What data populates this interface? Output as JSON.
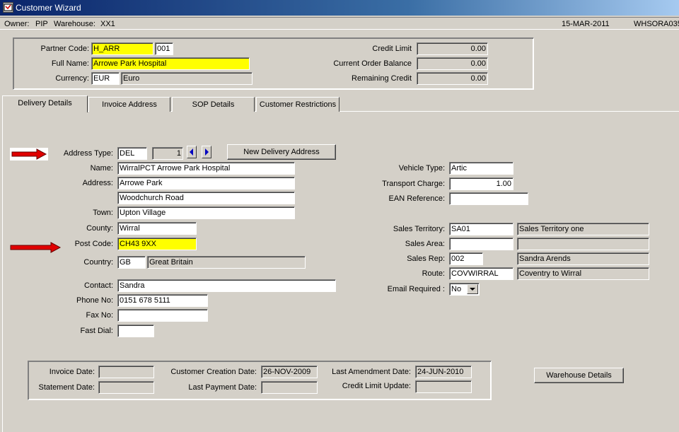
{
  "window": {
    "title": "Customer Wizard",
    "app_icon": "app-icon"
  },
  "infobar": {
    "owner_label": "Owner:",
    "owner": "PIP",
    "warehouse_label": "Warehouse:",
    "warehouse": "XX1",
    "date": "15-MAR-2011",
    "server": "WHSORA035"
  },
  "header": {
    "partner_code_label": "Partner Code:",
    "partner_code": "H_ARR",
    "partner_suffix": "001",
    "full_name_label": "Full Name:",
    "full_name": "Arrowe Park Hospital",
    "currency_label": "Currency:",
    "currency_code": "EUR",
    "currency_name": "Euro",
    "credit_limit_label": "Credit Limit",
    "credit_limit": "0.00",
    "current_order_balance_label": "Current Order Balance",
    "current_order_balance": "0.00",
    "remaining_credit_label": "Remaining Credit",
    "remaining_credit": "0.00"
  },
  "tabs": [
    {
      "label": "Delivery Details",
      "active": true
    },
    {
      "label": "Invoice Address",
      "active": false
    },
    {
      "label": "SOP Details",
      "active": false
    },
    {
      "label": "Customer Restrictions",
      "active": false
    }
  ],
  "delivery": {
    "address_type_label": "Address Type:",
    "address_type": "DEL",
    "address_index": "1",
    "new_delivery_address_button": "New Delivery Address",
    "name_label": "Name:",
    "name": "WirralPCT Arrowe Park Hospital",
    "address_label": "Address:",
    "address_line1": "Arrowe Park",
    "address_line2": "Woodchurch Road",
    "town_label": "Town:",
    "town": "Upton Village",
    "county_label": "County:",
    "county": "Wirral",
    "post_code_label": "Post Code:",
    "post_code": "CH43 9XX",
    "country_label": "Country:",
    "country_code": "GB",
    "country_name": "Great Britain",
    "contact_label": "Contact:",
    "contact": "Sandra",
    "phone_label": "Phone No:",
    "phone": "0151 678 5111",
    "fax_label": "Fax No:",
    "fax": "",
    "fast_dial_label": "Fast Dial:",
    "fast_dial": "",
    "vehicle_type_label": "Vehicle Type:",
    "vehicle_type": "Artic",
    "transport_charge_label": "Transport Charge:",
    "transport_charge": "1.00",
    "ean_reference_label": "EAN Reference:",
    "ean_reference": "",
    "sales_territory_label": "Sales Territory:",
    "sales_territory_code": "SA01",
    "sales_territory_name": "Sales Territory one",
    "sales_area_label": "Sales Area:",
    "sales_area_code": "",
    "sales_area_name": "",
    "sales_rep_label": "Sales Rep:",
    "sales_rep_code": "002",
    "sales_rep_name": "Sandra Arends",
    "route_label": "Route:",
    "route_code": "COVWIRRAL",
    "route_name": "Coventry to Wirral",
    "email_required_label": "Email Required :",
    "email_required": "No"
  },
  "dates": {
    "invoice_date_label": "Invoice Date:",
    "invoice_date": "",
    "statement_date_label": "Statement Date:",
    "statement_date": "",
    "customer_creation_date_label": "Customer Creation Date:",
    "customer_creation_date": "26-NOV-2009",
    "last_payment_date_label": "Last Payment Date:",
    "last_payment_date": "",
    "last_amendment_date_label": "Last Amendment Date:",
    "last_amendment_date": "24-JUN-2010",
    "credit_limit_update_label": "Credit Limit Update:",
    "credit_limit_update": ""
  },
  "warehouse_details_button": "Warehouse Details",
  "colors": {
    "highlight": "#ffff00",
    "arrow": "#e00000",
    "titlebar": "#0a246a",
    "background": "#d4d0c8"
  }
}
